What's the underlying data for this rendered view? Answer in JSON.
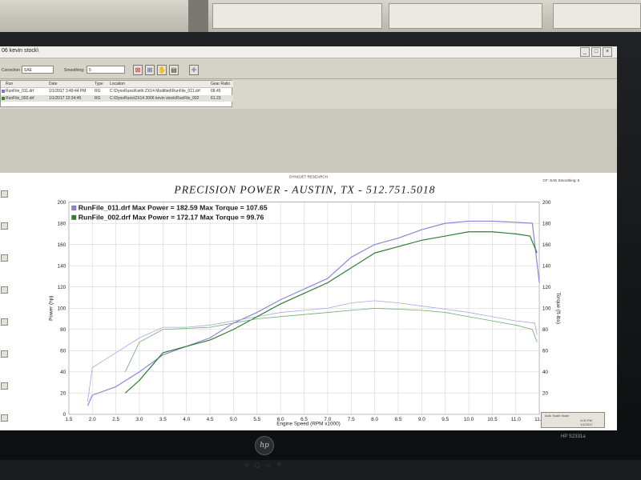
{
  "window": {
    "title": "06 kevin stock\\"
  },
  "toolbar": {
    "factor_label": "Correction Factor:",
    "factor_value": "SAE",
    "smoothing_label": "Smoothing:",
    "smoothing_value": "5"
  },
  "file_list": {
    "headers": [
      "Run",
      "Date",
      "Type",
      "Location",
      "Gear Ratio"
    ],
    "rows": [
      {
        "name": "RunFile_011.drf",
        "date": "1/1/2017 3:49:44 PM",
        "type": "RG",
        "location": "C:\\DynoRuns\\Keith ZX14 Modified\\RunFile_011.drf",
        "ratio": "68.45",
        "color": "#7b73d6"
      },
      {
        "name": "RunFile_002.drf",
        "date": "1/1/2017 12:34:45",
        "type": "RG",
        "location": "C:\\DynoRuns\\ZX14 2006 kevin stock\\RunFile_002",
        "ratio": "61.23",
        "color": "#2f8a36"
      }
    ]
  },
  "graph": {
    "brand": "DYNOJET RESEARCH",
    "status_right": "CF: SAE   Smoothing: 5",
    "footer_tab": "Auto Scale Mode",
    "status_time": "4:00 PM",
    "status_date": "1/1/2017"
  },
  "chart_data": {
    "type": "line",
    "title": "PRECISION POWER - AUSTIN, TX - 512.751.5018",
    "xlabel": "Engine Speed (RPM x1000)",
    "ylabel": "Power (hp)",
    "y2label": "Torque (ft-lbs)",
    "xlim": [
      1.5,
      11.5
    ],
    "ylim": [
      0,
      200
    ],
    "y2lim": [
      0,
      200
    ],
    "x_ticks": [
      "1.5",
      "2.0",
      "2.5",
      "3.0",
      "3.5",
      "4.0",
      "4.5",
      "5.0",
      "5.5",
      "6.0",
      "6.5",
      "7.0",
      "7.5",
      "8.0",
      "8.5",
      "9.0",
      "9.5",
      "10.0",
      "10.5",
      "11.0",
      "11.5"
    ],
    "y_ticks": [
      "0",
      "20",
      "40",
      "60",
      "80",
      "100",
      "120",
      "140",
      "160",
      "180",
      "200"
    ],
    "y2_ticks": [
      "0",
      "20",
      "40",
      "60",
      "80",
      "100",
      "120",
      "140",
      "160",
      "180",
      "200"
    ],
    "grid": true,
    "legend_position": "top-left",
    "legend": [
      "RunFile_011.drf Max Power = 182.59  Max Torque = 107.65",
      "RunFile_002.drf Max Power = 172.17  Max Torque = 99.76"
    ],
    "series": [
      {
        "color": "#8a85dc",
        "kind": "power",
        "values": [
          [
            1.9,
            8
          ],
          [
            2.0,
            18
          ],
          [
            2.5,
            26
          ],
          [
            3.0,
            40
          ],
          [
            3.5,
            56
          ],
          [
            4.0,
            64
          ],
          [
            4.5,
            72
          ],
          [
            5.0,
            86
          ],
          [
            5.5,
            96
          ],
          [
            6.0,
            108
          ],
          [
            6.5,
            118
          ],
          [
            7.0,
            128
          ],
          [
            7.5,
            148
          ],
          [
            8.0,
            160
          ],
          [
            8.5,
            166
          ],
          [
            9.0,
            174
          ],
          [
            9.5,
            180
          ],
          [
            10.0,
            182
          ],
          [
            10.5,
            182
          ],
          [
            11.0,
            181
          ],
          [
            11.35,
            180
          ],
          [
            11.5,
            124
          ]
        ]
      },
      {
        "color": "#aaa6e6",
        "kind": "torque",
        "values": [
          [
            1.9,
            12
          ],
          [
            2.0,
            44
          ],
          [
            2.5,
            58
          ],
          [
            3.0,
            72
          ],
          [
            3.5,
            82
          ],
          [
            4.0,
            82
          ],
          [
            4.5,
            84
          ],
          [
            5.0,
            88
          ],
          [
            5.5,
            92
          ],
          [
            6.0,
            96
          ],
          [
            6.5,
            98
          ],
          [
            7.0,
            100
          ],
          [
            7.5,
            105
          ],
          [
            8.0,
            107
          ],
          [
            8.5,
            105
          ],
          [
            9.0,
            102
          ],
          [
            9.5,
            99
          ],
          [
            10.0,
            96
          ],
          [
            10.5,
            92
          ],
          [
            11.0,
            88
          ],
          [
            11.4,
            86
          ],
          [
            11.45,
            75
          ]
        ]
      },
      {
        "color": "#2d7d32",
        "kind": "power",
        "values": [
          [
            2.7,
            20
          ],
          [
            3.0,
            32
          ],
          [
            3.5,
            58
          ],
          [
            4.0,
            64
          ],
          [
            4.5,
            70
          ],
          [
            5.0,
            80
          ],
          [
            5.5,
            92
          ],
          [
            6.0,
            104
          ],
          [
            6.5,
            114
          ],
          [
            7.0,
            124
          ],
          [
            7.5,
            138
          ],
          [
            8.0,
            152
          ],
          [
            8.5,
            158
          ],
          [
            9.0,
            164
          ],
          [
            9.5,
            168
          ],
          [
            10.0,
            172
          ],
          [
            10.5,
            172
          ],
          [
            11.0,
            170
          ],
          [
            11.3,
            168
          ],
          [
            11.45,
            152
          ]
        ]
      },
      {
        "color": "#6fae73",
        "kind": "torque",
        "values": [
          [
            2.7,
            40
          ],
          [
            3.0,
            68
          ],
          [
            3.5,
            80
          ],
          [
            4.0,
            81
          ],
          [
            4.5,
            82
          ],
          [
            5.0,
            86
          ],
          [
            5.5,
            90
          ],
          [
            6.0,
            92
          ],
          [
            6.5,
            94
          ],
          [
            7.0,
            96
          ],
          [
            7.5,
            98
          ],
          [
            8.0,
            99.8
          ],
          [
            8.5,
            99
          ],
          [
            9.0,
            98
          ],
          [
            9.5,
            96
          ],
          [
            10.0,
            92
          ],
          [
            10.5,
            88
          ],
          [
            11.0,
            84
          ],
          [
            11.35,
            80
          ],
          [
            11.45,
            68
          ]
        ]
      }
    ]
  },
  "monitor": {
    "logo": "hp",
    "model": "HP S2331a"
  },
  "monitor_buttons": [
    "◁",
    "◯",
    "▭",
    "⏻"
  ]
}
